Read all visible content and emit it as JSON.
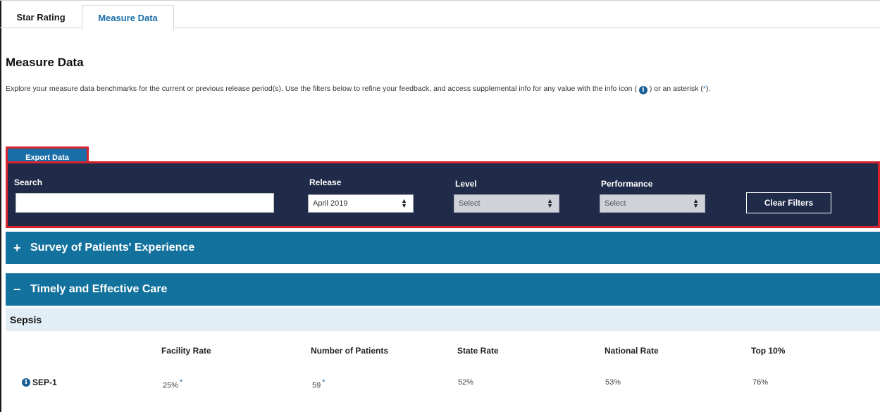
{
  "tabs": [
    {
      "label": "Star Rating"
    },
    {
      "label": "Measure Data"
    }
  ],
  "page": {
    "title": "Measure Data",
    "description_part1": "Explore your measure data benchmarks for the current or previous release period(s). Use the filters below to refine your feedback, and access supplemental info for any value with the info icon (",
    "description_part2": ") or an asterisk (",
    "asterisk": "*",
    "description_part3": ")."
  },
  "export_button": "Export Data",
  "filters": {
    "search_label": "Search",
    "search_value": "",
    "release_label": "Release",
    "release_value": "April 2019",
    "level_label": "Level",
    "level_value": "Select",
    "performance_label": "Performance",
    "performance_value": "Select",
    "clear_button": "Clear Filters"
  },
  "sections": [
    {
      "symbol": "+",
      "title": "Survey of Patients' Experience"
    },
    {
      "symbol": "−",
      "title": "Timely and Effective Care"
    }
  ],
  "subsection": "Sepsis",
  "table": {
    "columns": [
      "Facility Rate",
      "Number of Patients",
      "State Rate",
      "National Rate",
      "Top 10%"
    ],
    "rows": [
      {
        "measure": "SEP-1",
        "facility_rate": "25%",
        "facility_rate_flag": "*",
        "patients": "59",
        "patients_flag": "*",
        "state_rate": "52%",
        "national_rate": "53%",
        "top10": "76%"
      }
    ]
  },
  "icons": {
    "info": "info-icon"
  },
  "colors": {
    "accent": "#1a6fa8",
    "filter_bg": "#1f2b48",
    "section_bg": "#13729d",
    "highlight": "#d7242f"
  }
}
